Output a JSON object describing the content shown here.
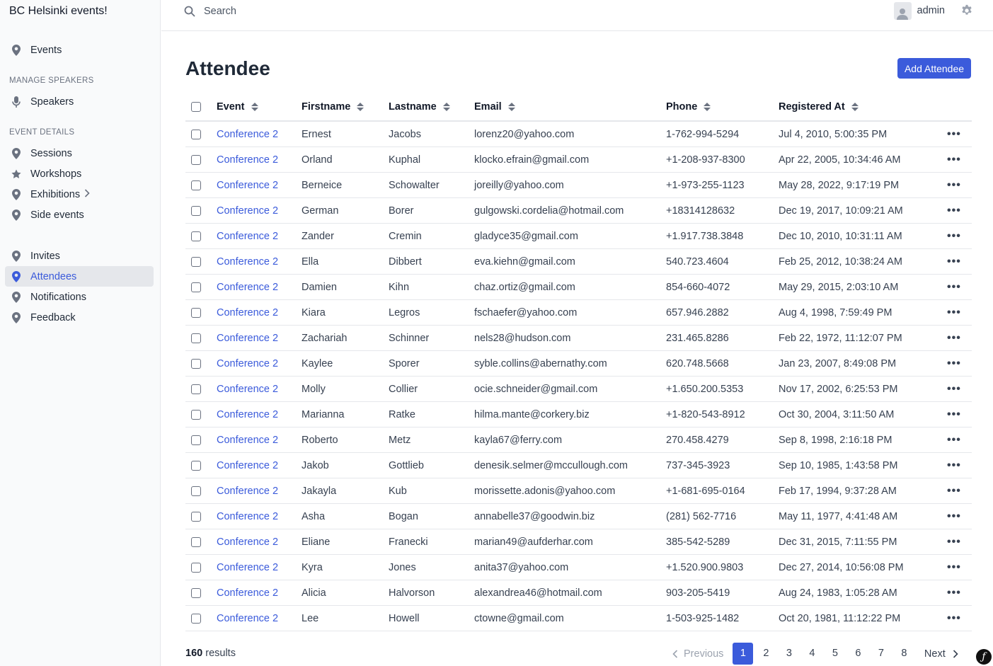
{
  "app": {
    "title": "BC Helsinki events!"
  },
  "sidebar": {
    "events": "Events",
    "section_speakers": "MANAGE SPEAKERS",
    "speakers": "Speakers",
    "section_details": "EVENT DETAILS",
    "sessions": "Sessions",
    "workshops": "Workshops",
    "exhibitions": "Exhibitions",
    "side_events": "Side events",
    "invites": "Invites",
    "attendees": "Attendees",
    "notifications": "Notifications",
    "feedback": "Feedback",
    "active_item": "Attendees"
  },
  "topbar": {
    "search_placeholder": "Search",
    "user": "admin"
  },
  "page": {
    "title": "Attendee",
    "add_button": "Add Attendee"
  },
  "table": {
    "columns": {
      "event": "Event",
      "firstname": "Firstname",
      "lastname": "Lastname",
      "email": "Email",
      "phone": "Phone",
      "registered_at": "Registered At"
    },
    "rows": [
      {
        "event": "Conference 2",
        "firstname": "Ernest",
        "lastname": "Jacobs",
        "email": "lorenz20@yahoo.com",
        "phone": "1-762-994-5294",
        "registered_at": "Jul 4, 2010, 5:00:35 PM"
      },
      {
        "event": "Conference 2",
        "firstname": "Orland",
        "lastname": "Kuphal",
        "email": "klocko.efrain@gmail.com",
        "phone": "+1-208-937-8300",
        "registered_at": "Apr 22, 2005, 10:34:46 AM"
      },
      {
        "event": "Conference 2",
        "firstname": "Berneice",
        "lastname": "Schowalter",
        "email": "joreilly@yahoo.com",
        "phone": "+1-973-255-1123",
        "registered_at": "May 28, 2022, 9:17:19 PM"
      },
      {
        "event": "Conference 2",
        "firstname": "German",
        "lastname": "Borer",
        "email": "gulgowski.cordelia@hotmail.com",
        "phone": "+18314128632",
        "registered_at": "Dec 19, 2017, 10:09:21 AM"
      },
      {
        "event": "Conference 2",
        "firstname": "Zander",
        "lastname": "Cremin",
        "email": "gladyce35@gmail.com",
        "phone": "+1.917.738.3848",
        "registered_at": "Dec 10, 2010, 10:31:11 AM"
      },
      {
        "event": "Conference 2",
        "firstname": "Ella",
        "lastname": "Dibbert",
        "email": "eva.kiehn@gmail.com",
        "phone": "540.723.4604",
        "registered_at": "Feb 25, 2012, 10:38:24 AM"
      },
      {
        "event": "Conference 2",
        "firstname": "Damien",
        "lastname": "Kihn",
        "email": "chaz.ortiz@gmail.com",
        "phone": "854-660-4072",
        "registered_at": "May 29, 2015, 2:03:10 AM"
      },
      {
        "event": "Conference 2",
        "firstname": "Kiara",
        "lastname": "Legros",
        "email": "fschaefer@yahoo.com",
        "phone": "657.946.2882",
        "registered_at": "Aug 4, 1998, 7:59:49 PM"
      },
      {
        "event": "Conference 2",
        "firstname": "Zachariah",
        "lastname": "Schinner",
        "email": "nels28@hudson.com",
        "phone": "231.465.8286",
        "registered_at": "Feb 22, 1972, 11:12:07 PM"
      },
      {
        "event": "Conference 2",
        "firstname": "Kaylee",
        "lastname": "Sporer",
        "email": "syble.collins@abernathy.com",
        "phone": "620.748.5668",
        "registered_at": "Jan 23, 2007, 8:49:08 PM"
      },
      {
        "event": "Conference 2",
        "firstname": "Molly",
        "lastname": "Collier",
        "email": "ocie.schneider@gmail.com",
        "phone": "+1.650.200.5353",
        "registered_at": "Nov 17, 2002, 6:25:53 PM"
      },
      {
        "event": "Conference 2",
        "firstname": "Marianna",
        "lastname": "Ratke",
        "email": "hilma.mante@corkery.biz",
        "phone": "+1-820-543-8912",
        "registered_at": "Oct 30, 2004, 3:11:50 AM"
      },
      {
        "event": "Conference 2",
        "firstname": "Roberto",
        "lastname": "Metz",
        "email": "kayla67@ferry.com",
        "phone": "270.458.4279",
        "registered_at": "Sep 8, 1998, 2:16:18 PM"
      },
      {
        "event": "Conference 2",
        "firstname": "Jakob",
        "lastname": "Gottlieb",
        "email": "denesik.selmer@mccullough.com",
        "phone": "737-345-3923",
        "registered_at": "Sep 10, 1985, 1:43:58 PM"
      },
      {
        "event": "Conference 2",
        "firstname": "Jakayla",
        "lastname": "Kub",
        "email": "morissette.adonis@yahoo.com",
        "phone": "+1-681-695-0164",
        "registered_at": "Feb 17, 1994, 9:37:28 AM"
      },
      {
        "event": "Conference 2",
        "firstname": "Asha",
        "lastname": "Bogan",
        "email": "annabelle37@goodwin.biz",
        "phone": "(281) 562-7716",
        "registered_at": "May 11, 1977, 4:41:48 AM"
      },
      {
        "event": "Conference 2",
        "firstname": "Eliane",
        "lastname": "Franecki",
        "email": "marian49@aufderhar.com",
        "phone": "385-542-5289",
        "registered_at": "Dec 31, 2015, 7:11:55 PM"
      },
      {
        "event": "Conference 2",
        "firstname": "Kyra",
        "lastname": "Jones",
        "email": "anita37@yahoo.com",
        "phone": "+1.520.900.9803",
        "registered_at": "Dec 27, 2014, 10:56:08 PM"
      },
      {
        "event": "Conference 2",
        "firstname": "Alicia",
        "lastname": "Halvorson",
        "email": "alexandrea46@hotmail.com",
        "phone": "903-205-5419",
        "registered_at": "Aug 24, 1983, 1:05:28 AM"
      },
      {
        "event": "Conference 2",
        "firstname": "Lee",
        "lastname": "Howell",
        "email": "ctowne@gmail.com",
        "phone": "1-503-925-1482",
        "registered_at": "Oct 20, 1981, 11:12:22 PM"
      }
    ],
    "row_actions": "•••"
  },
  "footer": {
    "results_count": "160",
    "results_label": "results",
    "previous": "Previous",
    "next": "Next",
    "pages": [
      "1",
      "2",
      "3",
      "4",
      "5",
      "6",
      "7",
      "8"
    ],
    "current_page": "1"
  },
  "colors": {
    "accent": "#3b5bdb",
    "sidebar_bg": "#f9fafb",
    "border": "#e5e7eb"
  },
  "icons": {
    "nav": "map-pin-icon",
    "speakers": "microphone-icon",
    "workshops": "star-icon",
    "search": "search-icon",
    "settings": "gear-icon",
    "user": "user-avatar-icon"
  }
}
